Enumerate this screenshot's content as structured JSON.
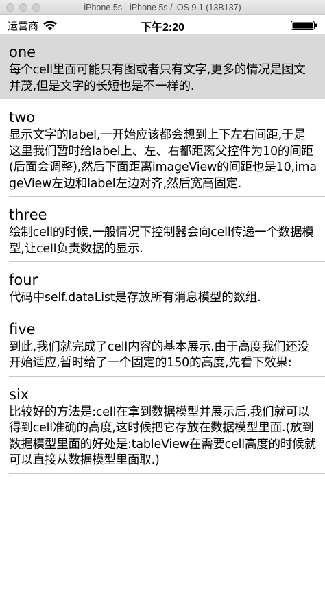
{
  "window": {
    "title": "iPhone 5s - iPhone 5s / iOS 9.1 (13B137)"
  },
  "status_bar": {
    "carrier": "运营商",
    "time": "下午2:20"
  },
  "cells": [
    {
      "title": "one",
      "body": "每个cell里面可能只有图或者只有文字,更多的情况是图文并茂,但是文字的长短也是不一样的.",
      "selected": true
    },
    {
      "title": "two",
      "body": "显示文字的label,一开始应该都会想到上下左右间距,于是这里我们暂时给label上、左、右都距离父控件为10的间距(后面会调整),然后下面距离imageView的间距也是10,imageView左边和label左边对齐,然后宽高固定."
    },
    {
      "title": "three",
      "body": "绘制cell的时候,一般情况下控制器会向cell传递一个数据模型,让cell负责数据的显示."
    },
    {
      "title": "four",
      "body": "代码中self.dataList是存放所有消息模型的数组."
    },
    {
      "title": "five",
      "body": "到此,我们就完成了cell内容的基本展示.由于高度我们还没开始适应,暂时给了一个固定的150的高度,先看下效果:"
    },
    {
      "title": "six",
      "body": "比较好的方法是:cell在拿到数据模型并展示后,我们就可以得到cell准确的高度,这时候把它存放在数据模型里面.(放到数据模型里面的好处是:tableView在需要cell高度的时候就可以直接从数据模型里面取.)"
    }
  ]
}
